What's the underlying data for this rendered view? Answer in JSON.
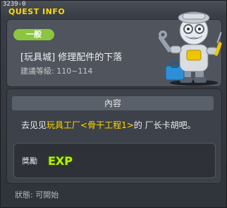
{
  "window": {
    "quest_id": "3239-0",
    "title": "QUEST INFO"
  },
  "quest": {
    "category": "一般",
    "name": "[玩具城] 修理配件的下落",
    "level_label": "建議等級",
    "level_sep": ":",
    "level_range": "110~114"
  },
  "content": {
    "header": "內容",
    "desc_pre": "去见见",
    "desc_place": "玩具工厂",
    "desc_lt": "<",
    "desc_sub": "骨干工程1",
    "desc_gt": ">",
    "desc_post": "的 厂长卡胡吧。"
  },
  "reward": {
    "label": "獎勵",
    "exp_text": "EXP"
  },
  "status": {
    "label": "狀態",
    "sep": ":",
    "value": "可開始"
  },
  "colors": {
    "title_yellow": "#ffd800",
    "badge_green": "#8cc63e",
    "exp_green": "#b4f000"
  },
  "icons": [
    "npc-portrait",
    "exp-icon"
  ]
}
